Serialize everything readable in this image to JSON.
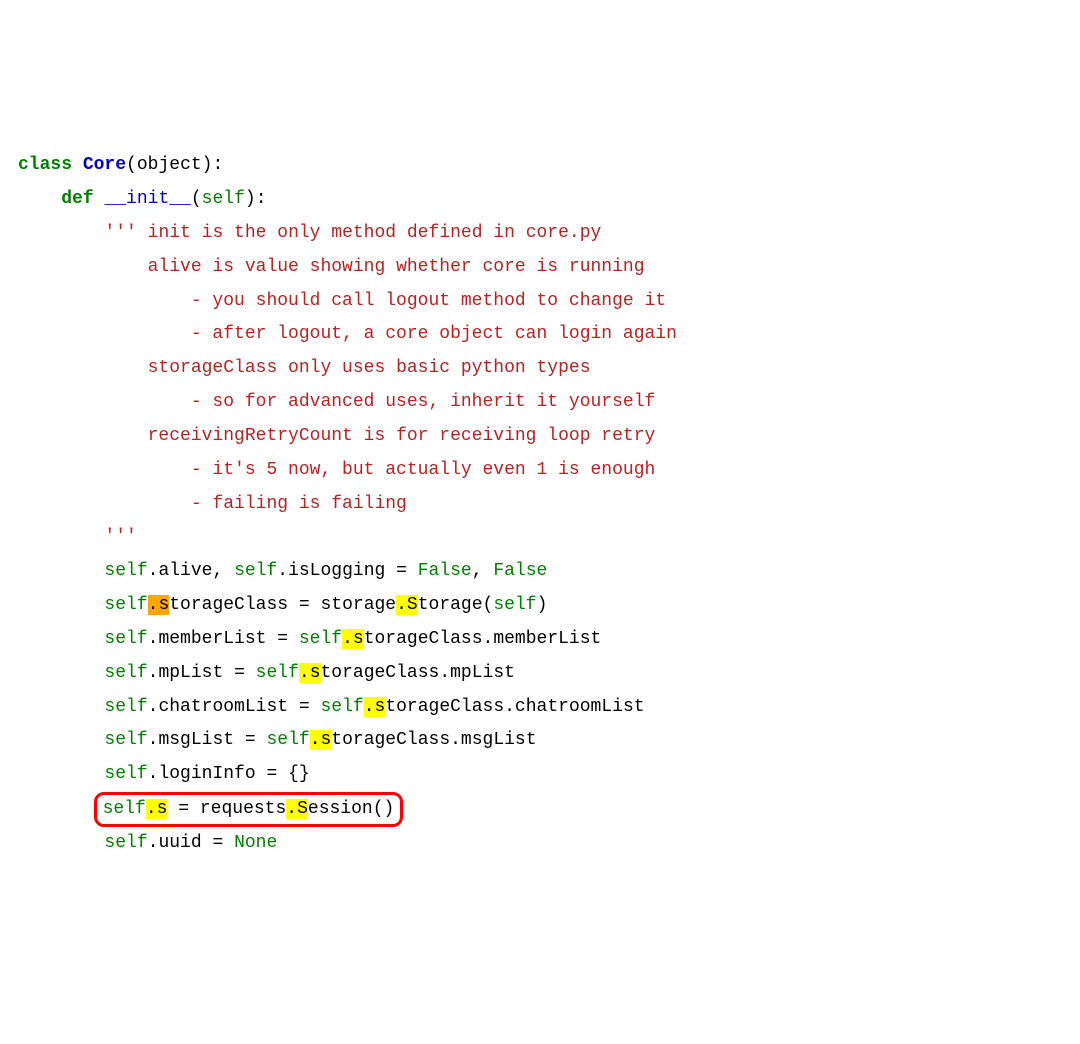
{
  "code": {
    "kw_class": "class",
    "cls_core": "Core",
    "kw_object": "object",
    "kw_def": "def",
    "fn_init": "__init__",
    "self": "self",
    "doc_open": "''' ",
    "doc_l1": "init is the only method defined in core.py",
    "doc_l2": "alive is value showing whether core is running",
    "doc_l3": "- you should call logout method to change it",
    "doc_l4": "- after logout, a core object can login again",
    "doc_l5": "storageClass only uses basic python types",
    "doc_l6": "- so for advanced uses, inherit it yourself",
    "doc_l7": "receivingRetryCount is for receiving loop retry",
    "doc_l8": "- it's 5 now, but actually even 1 is enough",
    "doc_l9": "- failing is failing",
    "doc_close": "'''",
    "alive": ".alive, ",
    "isLogging": ".isLogging ",
    "eq": "= ",
    "false": "False",
    "comma": ", ",
    "dot_s_hl": ".s",
    "torageClass": "torageClass ",
    "storage_mod": "storage",
    "dot_S_hl": ".S",
    "torage_call": "torage(",
    "memberList": ".memberList ",
    "eq_self": "= ",
    "torageClass_attr": "torageClass.memberList",
    "mpList": ".mpList ",
    "torageClass_mp": "torageClass.mpList",
    "chatroomList": ".chatroomList ",
    "torageClass_chat": "torageClass.chatroomList",
    "msgList": ".msgList ",
    "torageClass_msg": "torageClass.msgList",
    "loginInfo": ".loginInfo = {}",
    "boxed_self": "self",
    "boxed_dot_s": ".s",
    "boxed_eq": " = requests",
    "boxed_dot_Sess": ".S",
    "boxed_ession": "ession()",
    "uuid": ".uuid ",
    "none": "None",
    "paren_close": ")",
    "colon": ":",
    "paren_open": "("
  }
}
